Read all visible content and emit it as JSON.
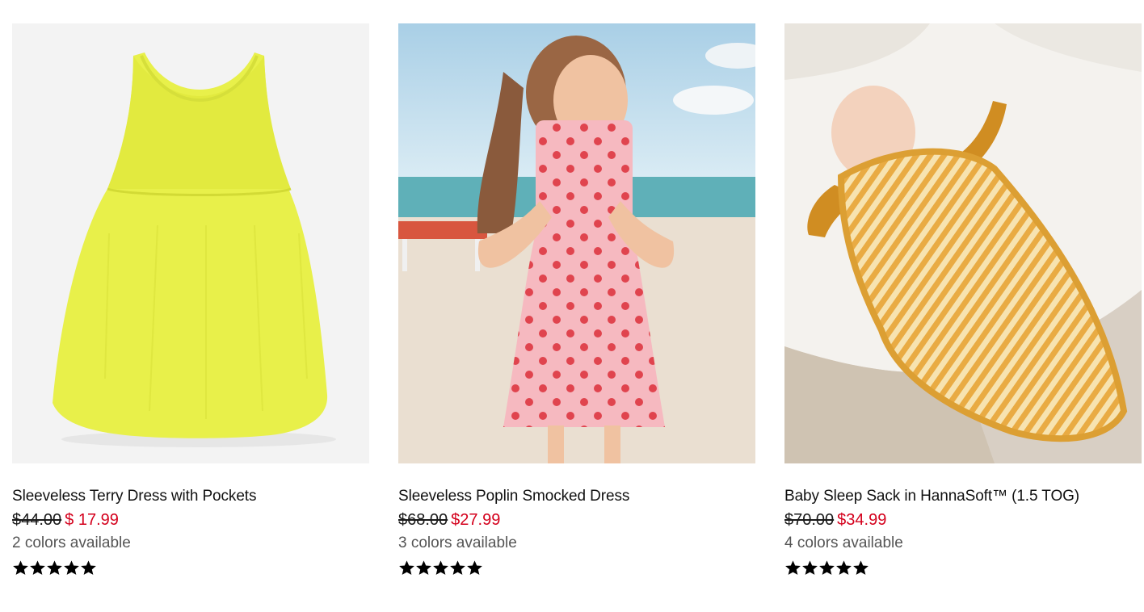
{
  "products": [
    {
      "title": "Sleeveless Terry Dress with Pockets",
      "original_price": "$44.00",
      "sale_price": "$ 17.99",
      "colors": "2 colors available",
      "rating": 5,
      "image": "yellow-terry-dress-image"
    },
    {
      "title": "Sleeveless Poplin Smocked Dress",
      "original_price": "$68.00",
      "sale_price": "$27.99",
      "colors": "3 colors available",
      "rating": 5,
      "image": "girl-in-pink-crab-print-dress-on-beach-image"
    },
    {
      "title": "Baby Sleep Sack in HannaSoft™ (1.5 TOG)",
      "original_price": "$70.00",
      "sale_price": "$34.99",
      "colors": "4 colors available",
      "rating": 5,
      "image": "baby-in-striped-sleep-sack-image"
    }
  ],
  "colors": {
    "sale": "#d4001c",
    "text": "#1a1a1a",
    "muted": "#555555",
    "star": "#000000"
  }
}
